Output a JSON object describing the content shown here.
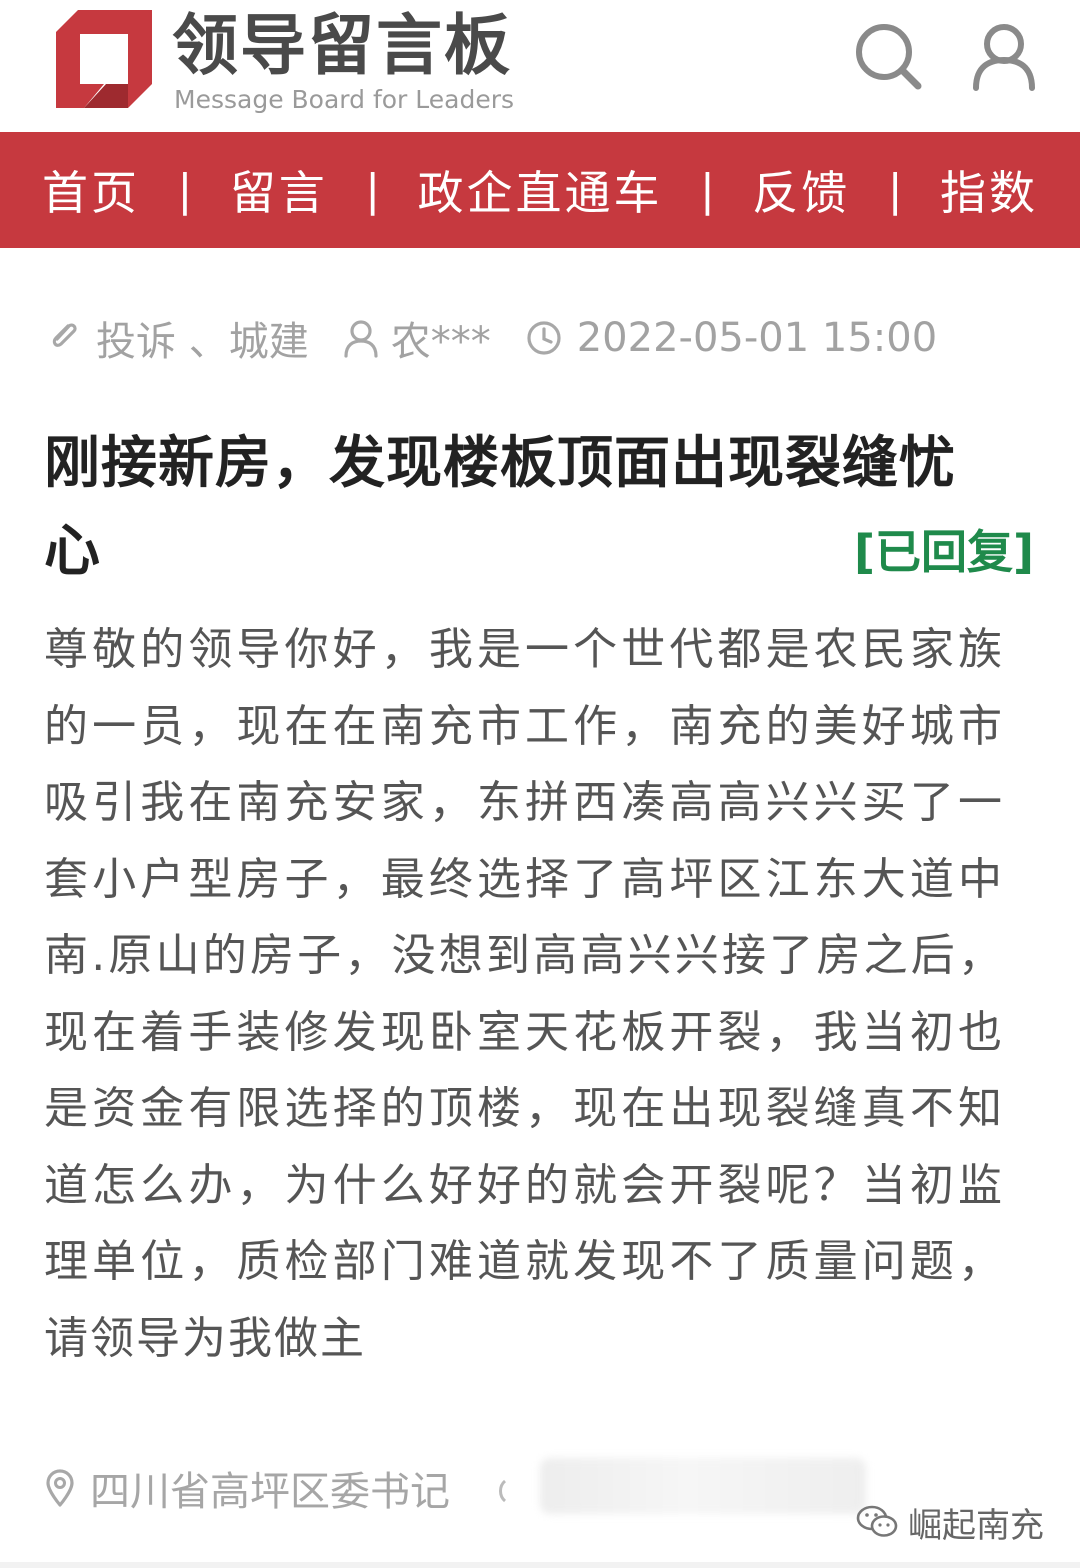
{
  "header": {
    "logo_cn": "领导留言板",
    "logo_en": "Message Board for Leaders",
    "icons": {
      "search": "search-icon",
      "user": "user-icon"
    }
  },
  "nav": {
    "items": [
      "首页",
      "留言",
      "政企直通车",
      "反馈",
      "指数"
    ],
    "separator": "|"
  },
  "meta": {
    "category": "投诉 、城建",
    "user": "农***",
    "datetime": "2022-05-01 15:00",
    "icons": {
      "category": "tag-icon",
      "user": "user-icon",
      "time": "clock-icon"
    }
  },
  "post": {
    "title": "刚接新房，发现楼板顶面出现裂缝忧心",
    "status": "[已回复]",
    "body": "尊敬的领导你好，我是一个世代都是农民家族的一员，现在在南充市工作，南充的美好城市吸引我在南充安家，东拼西凑高高兴兴买了一套小户型房子，最终选择了高坪区江东大道中南.原山的房子，没想到高高兴兴接了房之后，现在着手装修发现卧室天花板开裂，我当初也是资金有限选择的顶楼，现在出现裂缝真不知道怎么办，为什么好好的就会开裂呢？当初监理单位，质检部门难道就发现不了质量问题，请领导为我做主"
  },
  "footer": {
    "recipient": "四川省高坪区委书记",
    "icon": "location-icon"
  },
  "watermark": {
    "text": "崛起南充",
    "icon": "wechat-icon"
  },
  "colors": {
    "brand_red": "#c6393f",
    "replied_green": "#1f8a4b",
    "title_text": "#222222",
    "body_text": "#555555",
    "meta_text": "#a2a2a2"
  }
}
